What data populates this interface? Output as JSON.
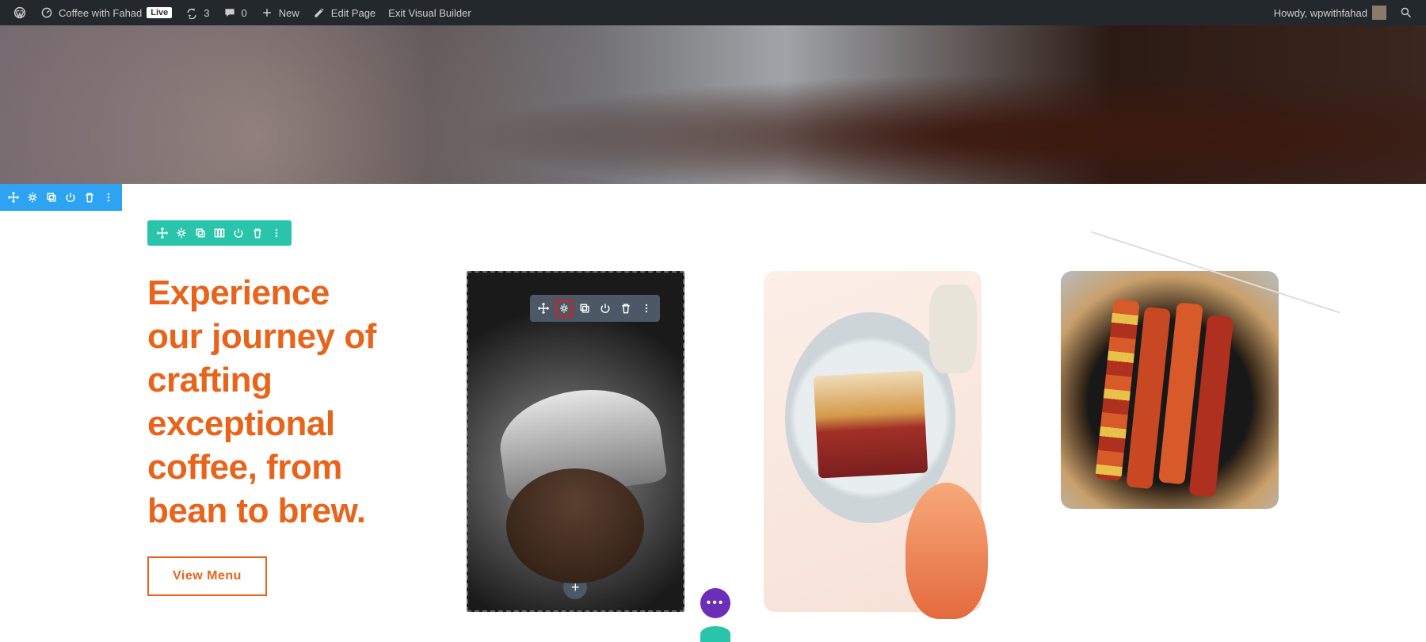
{
  "adminbar": {
    "site_name": "Coffee with Fahad",
    "live_badge": "Live",
    "updates_count": "3",
    "comments_count": "0",
    "new_label": "New",
    "edit_page": "Edit Page",
    "exit_vb": "Exit Visual Builder",
    "howdy": "Howdy, wpwithfahad"
  },
  "hero": {
    "heading": "Experience our journey of crafting exceptional coffee, from bean to brew.",
    "button": "View Menu"
  },
  "accent_color": "#e8641b",
  "toolbars": {
    "add_plus": "+"
  }
}
